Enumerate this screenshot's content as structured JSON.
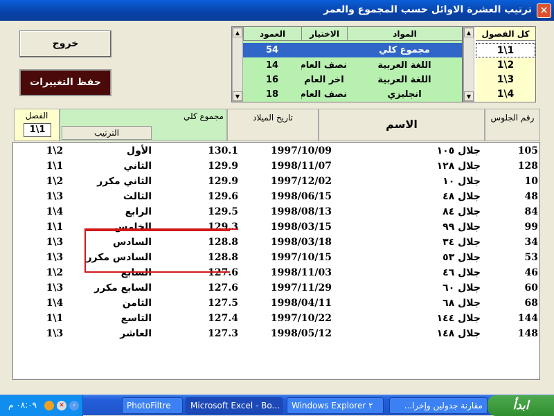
{
  "window": {
    "title": "ترتيب العشرة الاوائل حسب المجموع والعمر",
    "close_glyph": "✕"
  },
  "buttons": {
    "exit_label": "خروج",
    "save_label": "حفظ التغييرات"
  },
  "subjects": {
    "headers": {
      "subject": "المواد",
      "choice": "الاختيار",
      "column": "العمود"
    },
    "rows": [
      {
        "subject": "مجموع كلي",
        "choice": "",
        "column": "54",
        "selected": true
      },
      {
        "subject": "اللغة العربية",
        "choice": "نصف العام",
        "column": "14"
      },
      {
        "subject": "اللغة العربية",
        "choice": "اخر العام",
        "column": "16"
      },
      {
        "subject": "انجليزي",
        "choice": "نصف العام",
        "column": "18"
      }
    ]
  },
  "classes": {
    "header": "كل الفصول",
    "items": [
      "1\\1",
      "1\\2",
      "1\\3",
      "1\\4"
    ],
    "selected_index": 0
  },
  "columns": {
    "class_label": "الفصل",
    "class_value": "1\\1",
    "total": "مجموع كلي",
    "rank": "الترتيب",
    "birth_date": "تاريخ الميلاد",
    "name": "الاسم",
    "seat_no": "رقم الجلوس"
  },
  "results": [
    {
      "seat": "105",
      "name": "جلال ١٠٥",
      "date": "1997/10/09",
      "total": "130.1",
      "rank": "الأول",
      "class": "1\\2"
    },
    {
      "seat": "128",
      "name": "جلال ١٢٨",
      "date": "1998/11/07",
      "total": "129.9",
      "rank": "الثاني",
      "class": "1\\1"
    },
    {
      "seat": "10",
      "name": "جلال ١٠",
      "date": "1997/12/02",
      "total": "129.9",
      "rank": "الثاني مكرر",
      "class": "1\\2"
    },
    {
      "seat": "48",
      "name": "جلال ٤٨",
      "date": "1998/06/15",
      "total": "129.6",
      "rank": "الثالث",
      "class": "1\\3"
    },
    {
      "seat": "84",
      "name": "جلال ٨٤",
      "date": "1998/08/13",
      "total": "129.5",
      "rank": "الرابع",
      "class": "1\\4"
    },
    {
      "seat": "99",
      "name": "جلال ٩٩",
      "date": "1998/03/15",
      "total": "129.3",
      "rank": "الخامس",
      "class": "1\\1"
    },
    {
      "seat": "34",
      "name": "جلال ٣٤",
      "date": "1998/03/18",
      "total": "128.8",
      "rank": "السادس",
      "class": "1\\3"
    },
    {
      "seat": "53",
      "name": "جلال ٥٣",
      "date": "1997/10/15",
      "total": "128.8",
      "rank": "السادس مكرر",
      "class": "1\\3"
    },
    {
      "seat": "46",
      "name": "جلال ٤٦",
      "date": "1998/11/03",
      "total": "127.6",
      "rank": "السابع",
      "class": "1\\2"
    },
    {
      "seat": "60",
      "name": "جلال ٦٠",
      "date": "1997/11/29",
      "total": "127.6",
      "rank": "السابع مكرر",
      "class": "1\\3"
    },
    {
      "seat": "68",
      "name": "جلال ٦٨",
      "date": "1998/04/11",
      "total": "127.5",
      "rank": "الثامن",
      "class": "1\\4"
    },
    {
      "seat": "144",
      "name": "جلال ١٤٤",
      "date": "1997/10/22",
      "total": "127.4",
      "rank": "التاسع",
      "class": "1\\1"
    },
    {
      "seat": "148",
      "name": "جلال ١٤٨",
      "date": "1998/05/12",
      "total": "127.3",
      "rank": "العاشر",
      "class": "1\\3"
    }
  ],
  "taskbar": {
    "start_label": "ابدأ",
    "items": [
      "مقارنة جدولين وإخرا...",
      "Windows Explorer ٢",
      "Microsoft Excel - Bo...",
      "PhotoFiltre"
    ],
    "clock": "٠٨:٠٩ م"
  },
  "colors": {
    "accent": "#2f66c8",
    "subjects_bg": "#b8f0b0",
    "class_bg": "#ffffcc",
    "save_bg": "#4a0a0a",
    "highlight_box": "#d01818"
  }
}
